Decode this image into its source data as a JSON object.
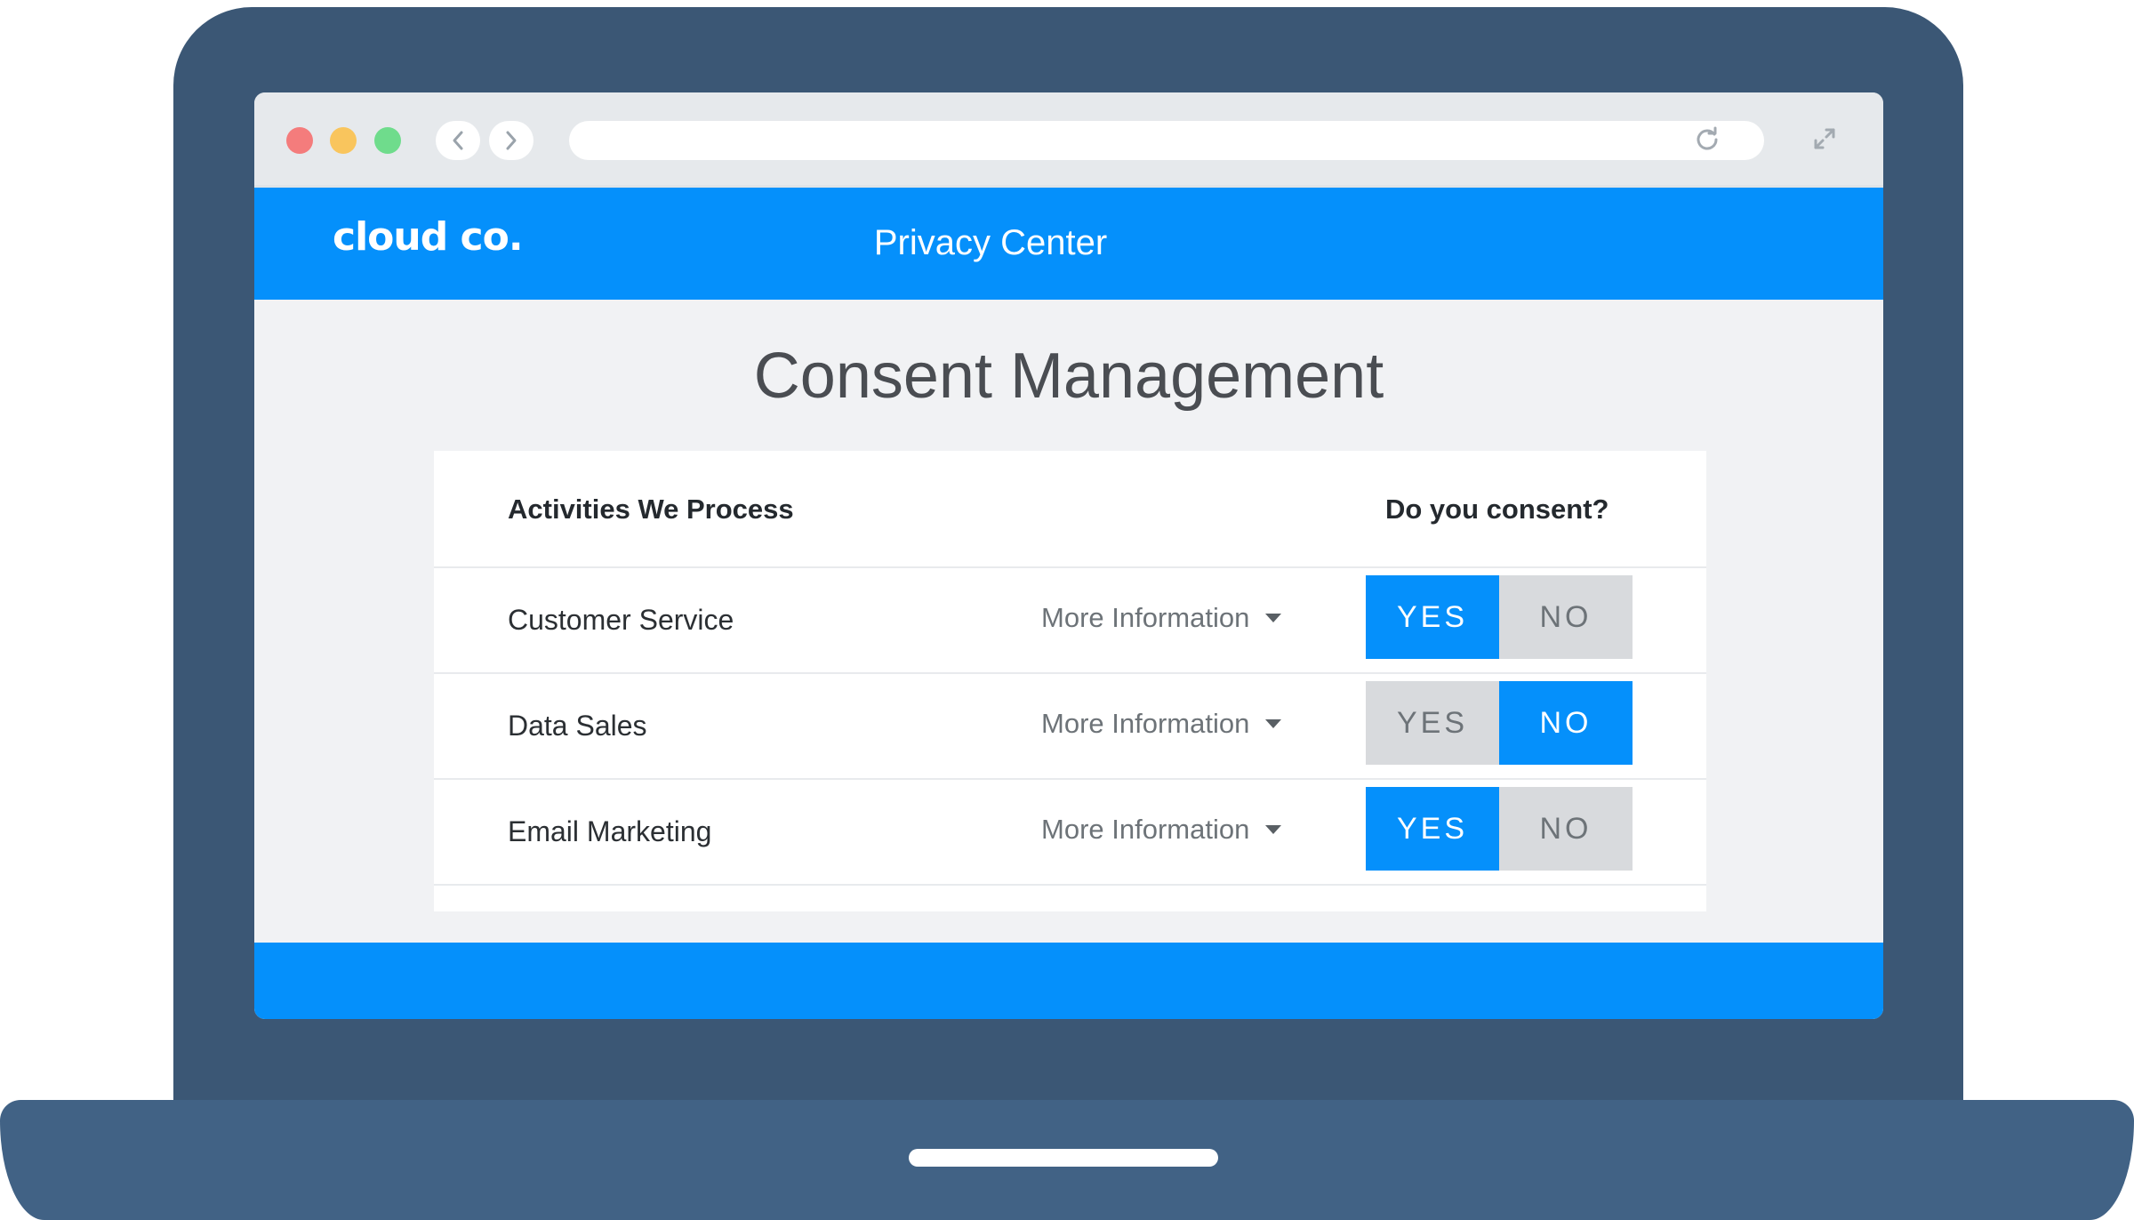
{
  "site": {
    "logo_text": "cloud co.",
    "header_title": "Privacy Center"
  },
  "page": {
    "heading": "Consent Management"
  },
  "table": {
    "col_activity": "Activities We Process",
    "col_consent": "Do you consent?",
    "rows": [
      {
        "label": "Customer Service",
        "more_info": "More Information",
        "yes": "YES",
        "no": "NO",
        "selected": "YES"
      },
      {
        "label": "Data Sales",
        "more_info": "More Information",
        "yes": "YES",
        "no": "NO",
        "selected": "NO"
      },
      {
        "label": "Email Marketing",
        "more_info": "More Information",
        "yes": "YES",
        "no": "NO",
        "selected": "YES"
      }
    ]
  },
  "colors": {
    "accent": "#0590fb",
    "frame": "#3b5775",
    "inactive": "#d8dadd"
  }
}
